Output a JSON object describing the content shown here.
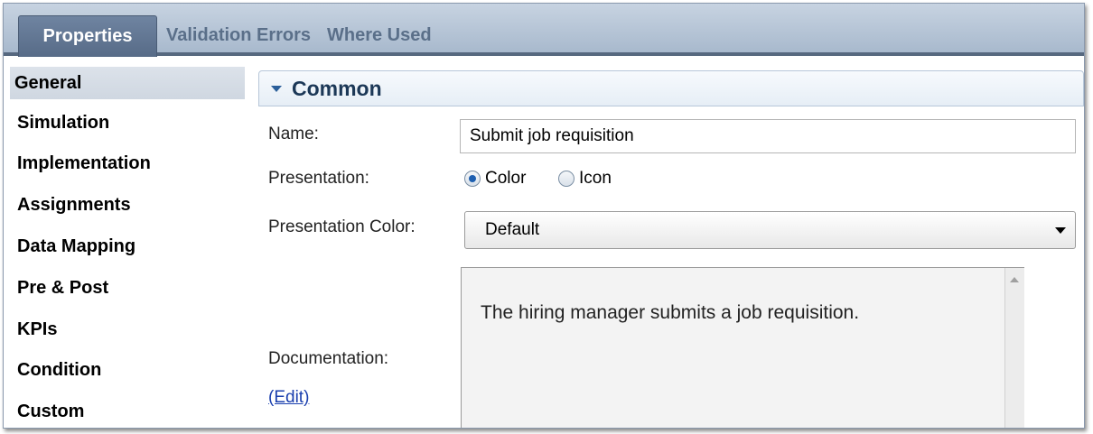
{
  "tabs": [
    "Properties",
    "Validation Errors",
    "Where Used"
  ],
  "sidebar": {
    "items": [
      "General",
      "Simulation",
      "Implementation",
      "Assignments",
      "Data Mapping",
      "Pre & Post",
      "KPIs",
      "Condition",
      "Custom"
    ],
    "selected": "General"
  },
  "section": {
    "title": "Common"
  },
  "fields": {
    "name_label": "Name:",
    "name_value": "Submit job requisition",
    "presentation_label": "Presentation:",
    "presentation_options": [
      "Color",
      "Icon"
    ],
    "presentation_selected": "Color",
    "presentation_color_label": "Presentation Color:",
    "presentation_color_value": "Default",
    "documentation_label": "Documentation:",
    "documentation_edit_link": "(Edit)",
    "documentation_text": "The hiring manager submits a job requisition."
  },
  "icons": [
    "twisty-collapse-icon",
    "dropdown-arrow-icon",
    "scroll-up-icon"
  ],
  "colors": {
    "tab_bar": "#a8b9cd",
    "active_tab": "#5f7490",
    "section_header": "#e6eef6",
    "link": "#1a3fae"
  }
}
